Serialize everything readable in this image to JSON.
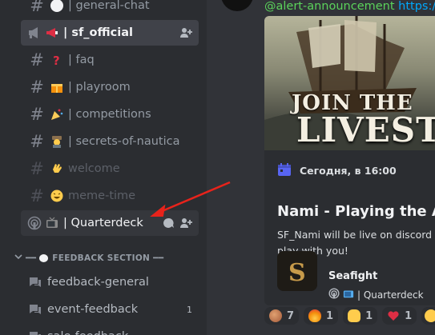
{
  "sidebar": {
    "channels": [
      {
        "name": "| general-chat",
        "emoji": "speech-bubble-icon",
        "state": "normal"
      },
      {
        "name": "| sf_official",
        "emoji": "megaphone-icon",
        "state": "active"
      },
      {
        "name": "| faq",
        "emoji": "question-mark-icon",
        "state": "normal"
      },
      {
        "name": "| playroom",
        "emoji": "gift-icon",
        "state": "normal"
      },
      {
        "name": "| competitions",
        "emoji": "party-popper-icon",
        "state": "normal"
      },
      {
        "name": "| secrets-of-nautica",
        "emoji": "detective-icon",
        "state": "normal"
      },
      {
        "name": "welcome",
        "emoji": "waving-hand-icon",
        "state": "muted"
      },
      {
        "name": "meme-time",
        "emoji": "laughing-face-icon",
        "state": "muted"
      },
      {
        "name": "| Quarterdeck",
        "emoji": "television-icon",
        "state": "hover"
      }
    ],
    "section_header": "FEEDBACK SECTION",
    "forums": [
      {
        "name": "feedback-general",
        "count": ""
      },
      {
        "name": "event-feedback",
        "count": "1"
      },
      {
        "name": "sale-feedback",
        "count": ""
      }
    ]
  },
  "message": {
    "mention": "@alert-announcement",
    "link": "https://"
  },
  "event": {
    "banner_line1": "JOIN THE",
    "banner_line2": "LIVEST",
    "time": "Сегодня, в 16:00",
    "title": "Nami - Playing the Abys",
    "description": "SF_Nami will be live on discord to play with you!",
    "org_name": "Seafight",
    "org_channel": "| Quarterdeck"
  },
  "reactions": [
    {
      "emoji": "pirate-icon",
      "count": "7"
    },
    {
      "emoji": "fire-icon",
      "count": "1"
    },
    {
      "emoji": "pointing-up-icon",
      "count": "1"
    },
    {
      "emoji": "heart-icon",
      "count": "1"
    }
  ],
  "colors": {
    "accent_link": "#00a8fc",
    "mention": "#5bd35b",
    "arrow": "#e8231b"
  }
}
